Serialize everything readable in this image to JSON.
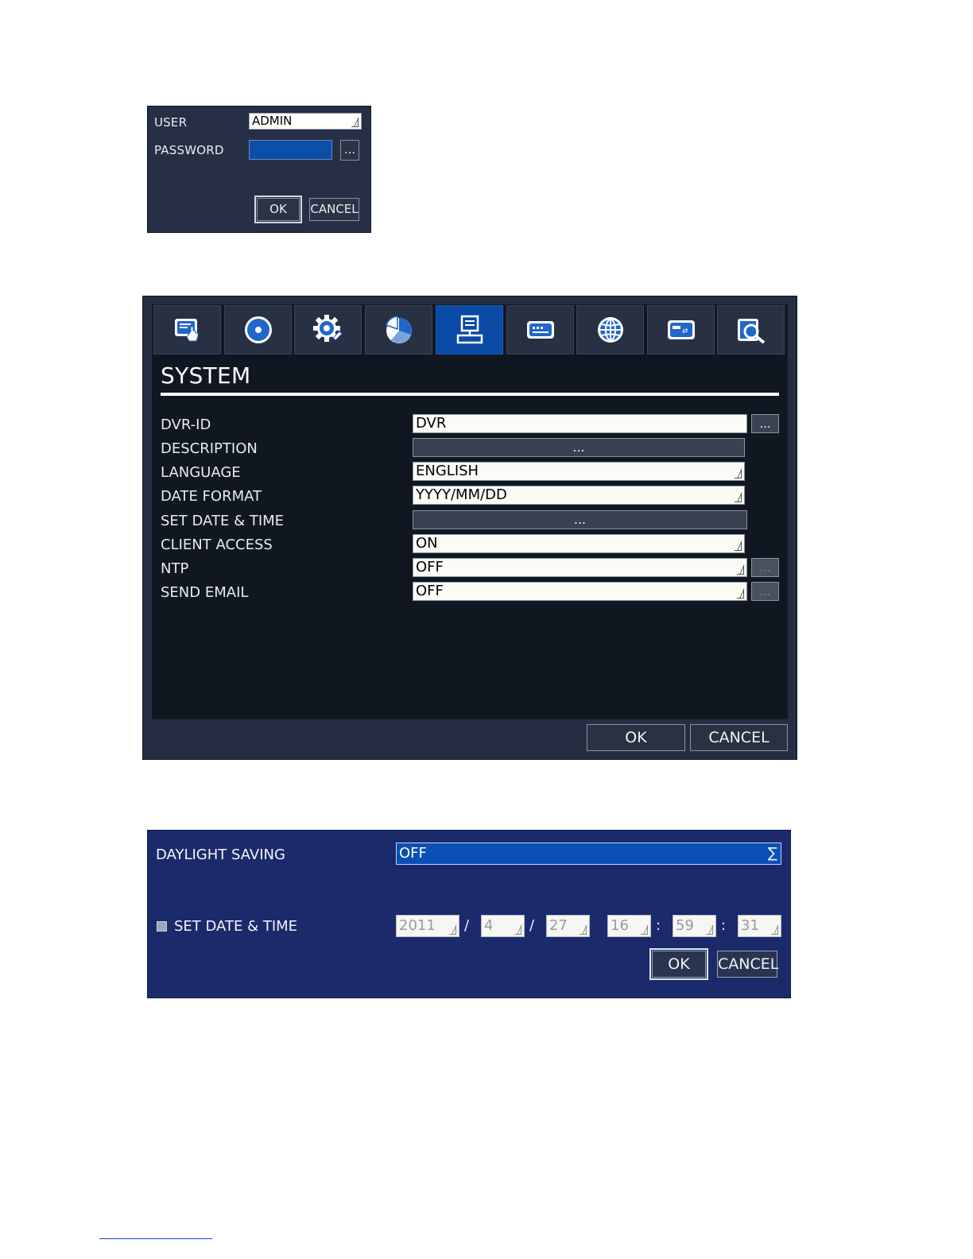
{
  "login": {
    "user_label": "USER",
    "user_value": "ADMIN",
    "password_label": "PASSWORD",
    "password_dots": "...",
    "ok": "OK",
    "cancel": "CANCEL"
  },
  "system": {
    "tabs": [
      {
        "icon": "display-touch-icon"
      },
      {
        "icon": "record-disc-icon"
      },
      {
        "icon": "gear-icon"
      },
      {
        "icon": "pie-chart-icon"
      },
      {
        "icon": "computer-system-icon",
        "active": true
      },
      {
        "icon": "keyboard-device-icon"
      },
      {
        "icon": "globe-network-icon"
      },
      {
        "icon": "storage-transfer-icon"
      },
      {
        "icon": "search-log-icon"
      }
    ],
    "title": "SYSTEM",
    "rows": {
      "dvr_id": {
        "label": "DVR-ID",
        "value": "DVR",
        "button": "..."
      },
      "description": {
        "label": "DESCRIPTION",
        "button": "..."
      },
      "language": {
        "label": "LANGUAGE",
        "value": "ENGLISH"
      },
      "date_format": {
        "label": "DATE FORMAT",
        "value": "YYYY/MM/DD"
      },
      "set_date_time": {
        "label": "SET DATE & TIME",
        "button": "..."
      },
      "client_access": {
        "label": "CLIENT ACCESS",
        "value": "ON"
      },
      "ntp": {
        "label": "NTP",
        "value": "OFF",
        "button": "..."
      },
      "send_email": {
        "label": "SEND EMAIL",
        "value": "OFF",
        "button": "..."
      }
    },
    "ok": "OK",
    "cancel": "CANCEL"
  },
  "datetime": {
    "daylight_label": "DAYLIGHT SAVING",
    "daylight_value": "OFF",
    "set_label": "SET DATE & TIME",
    "year": "2011",
    "month": "4",
    "day": "27",
    "hour": "16",
    "minute": "59",
    "second": "31",
    "date_sep": "/",
    "time_sep": ":",
    "ok": "OK",
    "cancel": "CANCEL"
  }
}
